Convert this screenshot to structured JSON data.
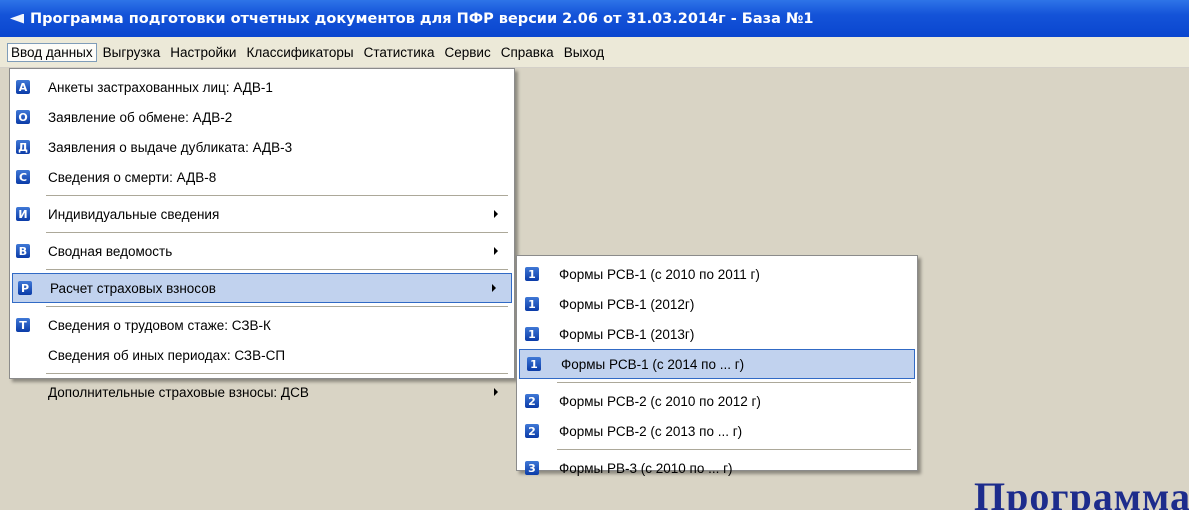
{
  "window": {
    "title": "Программа подготовки отчетных документов для ПФР версии 2.06 от 31.03.2014г - База №1"
  },
  "menubar": {
    "items": [
      "Ввод данных",
      "Выгрузка",
      "Настройки",
      "Классификаторы",
      "Статистика",
      "Сервис",
      "Справка",
      "Выход"
    ],
    "active_index": 0
  },
  "main_menu": {
    "items": [
      {
        "icon_letter": "А",
        "label": "Анкеты застрахованных лиц: АДВ-1"
      },
      {
        "icon_letter": "О",
        "label": "Заявление об обмене: АДВ-2"
      },
      {
        "icon_letter": "Д",
        "label": "Заявления о выдаче дубликата: АДВ-3"
      },
      {
        "icon_letter": "С",
        "label": "Сведения о смерти: АДВ-8"
      },
      {
        "icon_letter": "И",
        "label": "Индивидуальные сведения"
      },
      {
        "icon_letter": "В",
        "label": "Сводная ведомость"
      },
      {
        "icon_letter": "Р",
        "label": "Расчет страховых взносов"
      },
      {
        "icon_letter": "Т",
        "label": "Сведения о трудовом стаже: СЗВ-К"
      },
      {
        "icon_letter": "",
        "label": "Сведения об иных периодах: СЗВ-СП"
      },
      {
        "icon_letter": "",
        "label": "Дополнительные страховые взносы: ДСВ"
      }
    ]
  },
  "sub_menu": {
    "items": [
      {
        "icon_letter": "1",
        "label": "Формы РСВ-1 (с 2010 по 2011 г)"
      },
      {
        "icon_letter": "1",
        "label": "Формы РСВ-1 (2012г)"
      },
      {
        "icon_letter": "1",
        "label": "Формы РСВ-1 (2013г)"
      },
      {
        "icon_letter": "1",
        "label": "Формы РСВ-1 (с 2014 по ... г)"
      },
      {
        "icon_letter": "2",
        "label": "Формы РСВ-2 (с 2010 по 2012 г)"
      },
      {
        "icon_letter": "2",
        "label": "Формы РСВ-2 (с 2013 по ... г)"
      },
      {
        "icon_letter": "3",
        "label": "Формы РВ-3 (с 2010 по ... г)"
      }
    ]
  },
  "background": {
    "brand_text": "Программа"
  },
  "colors": {
    "titlebar": "#0a46cf",
    "menu_highlight": "#c1d2ee",
    "workspace": "#d9d4c5",
    "brand": "#1d2c8c"
  }
}
